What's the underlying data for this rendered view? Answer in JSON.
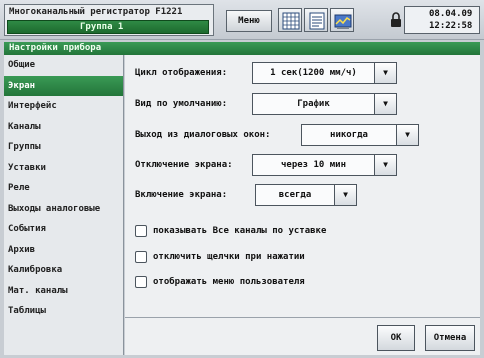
{
  "header": {
    "app_title": "Многоканальный регистратор F1221",
    "group_label": "Группа 1",
    "menu_label": "Меню",
    "date": "08.04.09",
    "time": "12:22:58"
  },
  "window": {
    "title": "Настройки прибора"
  },
  "sidebar": {
    "items": [
      {
        "label": "Общие"
      },
      {
        "label": "Экран"
      },
      {
        "label": "Интерфейс"
      },
      {
        "label": "Каналы"
      },
      {
        "label": "Группы"
      },
      {
        "label": "Уставки"
      },
      {
        "label": "Реле"
      },
      {
        "label": "Выходы аналоговые"
      },
      {
        "label": "События"
      },
      {
        "label": "Архив"
      },
      {
        "label": "Калибровка"
      },
      {
        "label": "Мат. каналы"
      },
      {
        "label": "Таблицы"
      }
    ],
    "active_index": 1
  },
  "settings": {
    "cycle_label": "Цикл отображения:",
    "cycle_value": "1 сек(1200 мм/ч)",
    "default_view_label": "Вид по умолчанию:",
    "default_view_value": "График",
    "dialog_exit_label": "Выход из диалоговых окон:",
    "dialog_exit_value": "никогда",
    "screen_off_label": "Отключение экрана:",
    "screen_off_value": "через 10 мин",
    "screen_on_label": "Включение экрана:",
    "screen_on_value": "всегда"
  },
  "checkboxes": {
    "show_all_channels": "показывать Все каналы по уставке",
    "disable_clicks": "отключить щелчки при нажатии",
    "show_user_menu": "отображать меню пользователя"
  },
  "buttons": {
    "ok": "ОК",
    "cancel": "Отмена"
  },
  "icons": {
    "dropdown": "▼",
    "lock": "lock-icon",
    "grid": "grid-view-icon",
    "list": "list-view-icon",
    "chart": "chart-view-icon"
  },
  "colors": {
    "accent_green": "#2a8443",
    "panel_bg": "#eef0f2"
  }
}
